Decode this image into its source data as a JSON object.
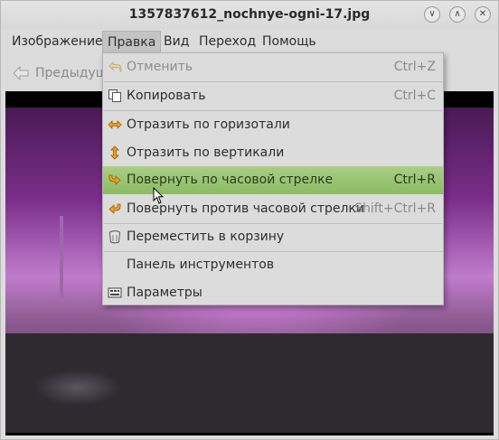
{
  "window": {
    "title": "1357837612_nochnye-ogni-17.jpg"
  },
  "menubar": {
    "items": [
      {
        "label": "Изображение"
      },
      {
        "label": "Правка"
      },
      {
        "label": "Вид"
      },
      {
        "label": "Переход"
      },
      {
        "label": "Помощь"
      }
    ]
  },
  "toolbar": {
    "prev_label": "Предыдущ"
  },
  "edit_menu": {
    "items": [
      {
        "label": "Отменить",
        "shortcut": "Ctrl+Z",
        "icon": "undo-icon",
        "disabled": true
      },
      {
        "label": "Копировать",
        "shortcut": "Ctrl+C",
        "icon": "copy-icon"
      },
      {
        "label": "Отразить по горизотали",
        "shortcut": "",
        "icon": "flip-horizontal-icon"
      },
      {
        "label": "Отразить по вертикали",
        "shortcut": "",
        "icon": "flip-vertical-icon"
      },
      {
        "label": "Повернуть по часовой стрелке",
        "shortcut": "Ctrl+R",
        "icon": "rotate-clockwise-icon",
        "highlighted": true
      },
      {
        "label": "Повернуть против часовой стрелки",
        "shortcut": "Shift+Ctrl+R",
        "icon": "rotate-counterclockwise-icon"
      },
      {
        "label": "Переместить в корзину",
        "shortcut": "",
        "icon": "trash-icon"
      },
      {
        "label": "Панель инструментов",
        "shortcut": "",
        "icon": ""
      },
      {
        "label": "Параметры",
        "shortcut": "",
        "icon": "preferences-icon"
      }
    ]
  },
  "colors": {
    "highlight": "#9cc574",
    "menu_bg": "#dcdcdc",
    "accent_icon": "#e0a020"
  }
}
